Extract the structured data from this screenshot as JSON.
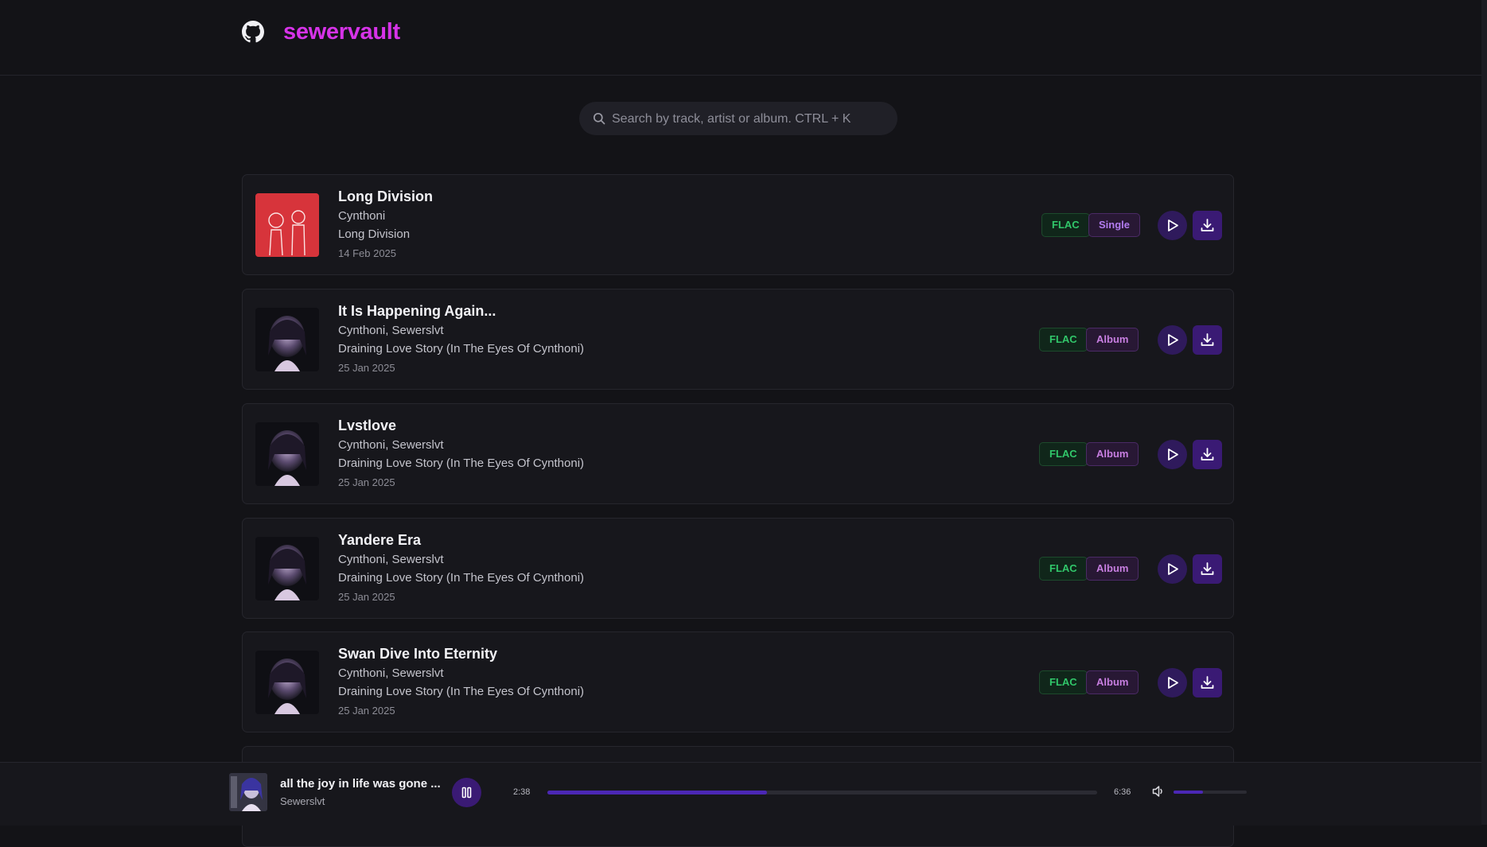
{
  "header": {
    "brand": "sewervault",
    "github_icon": "github-icon"
  },
  "search": {
    "placeholder": "Search by track, artist or album. CTRL + K",
    "value": "",
    "icon": "search-icon"
  },
  "tracks": [
    {
      "title": "Long Division",
      "artist": "Cynthoni",
      "album": "Long Division",
      "date": "14 Feb 2025",
      "format": "FLAC",
      "kind": "Single"
    },
    {
      "title": "It Is Happening Again...",
      "artist": "Cynthoni, Sewerslvt",
      "album": "Draining Love Story (In The Eyes Of Cynthoni)",
      "date": "25 Jan 2025",
      "format": "FLAC",
      "kind": "Album"
    },
    {
      "title": "Lvstlove",
      "artist": "Cynthoni, Sewerslvt",
      "album": "Draining Love Story (In The Eyes Of Cynthoni)",
      "date": "25 Jan 2025",
      "format": "FLAC",
      "kind": "Album"
    },
    {
      "title": "Yandere Era",
      "artist": "Cynthoni, Sewerslvt",
      "album": "Draining Love Story (In The Eyes Of Cynthoni)",
      "date": "25 Jan 2025",
      "format": "FLAC",
      "kind": "Album"
    },
    {
      "title": "Swan Dive Into Eternity",
      "artist": "Cynthoni, Sewerslvt",
      "album": "Draining Love Story (In The Eyes Of Cynthoni)",
      "date": "25 Jan 2025",
      "format": "FLAC",
      "kind": "Album"
    }
  ],
  "player": {
    "title": "all the joy in life was gone ...",
    "artist": "Sewerslvt",
    "elapsed": "2:38",
    "duration": "6:36",
    "progress_fraction": 0.4,
    "volume_fraction": 0.4
  },
  "colors": {
    "brand": "#d633e8",
    "accent": "#3a1a74",
    "progress": "#4b27b5",
    "flac": "#31c76a",
    "album": "#c77ee0"
  }
}
